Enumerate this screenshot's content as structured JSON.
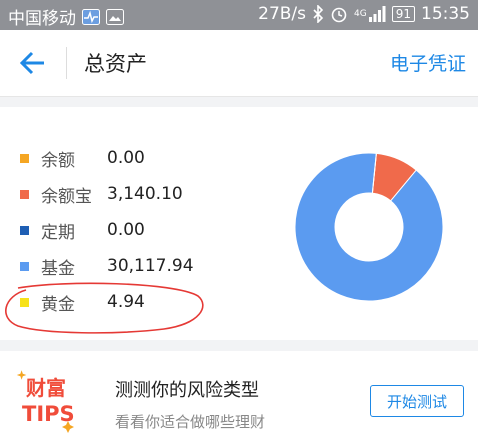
{
  "status_bar": {
    "carrier": "中国移动",
    "speed": "27B/s",
    "network": "4G",
    "battery": "91",
    "time": "15:35"
  },
  "nav": {
    "title": "总资产",
    "right_link": "电子凭证"
  },
  "assets": {
    "items": [
      {
        "label": "余额",
        "value": "0.00",
        "color": "#f5a623"
      },
      {
        "label": "余额宝",
        "value": "3,140.10",
        "color": "#f06a4b"
      },
      {
        "label": "定期",
        "value": "0.00",
        "color": "#1f5fb4"
      },
      {
        "label": "基金",
        "value": "30,117.94",
        "color": "#5b9bf0"
      },
      {
        "label": "黄金",
        "value": "4.94",
        "color": "#f7e21a"
      }
    ]
  },
  "chart_data": {
    "type": "pie",
    "categories": [
      "余额",
      "余额宝",
      "定期",
      "基金",
      "黄金"
    ],
    "values": [
      0.0,
      3140.1,
      0.0,
      30117.94,
      4.94
    ],
    "colors": [
      "#f5a623",
      "#f06a4b",
      "#1f5fb4",
      "#5b9bf0",
      "#f7e21a"
    ],
    "donut": true
  },
  "tips": {
    "logo_line1": "财富",
    "logo_line2": "TIPS",
    "title": "测测你的风险类型",
    "subtitle": "看看你适合做哪些理财",
    "button": "开始测试"
  }
}
